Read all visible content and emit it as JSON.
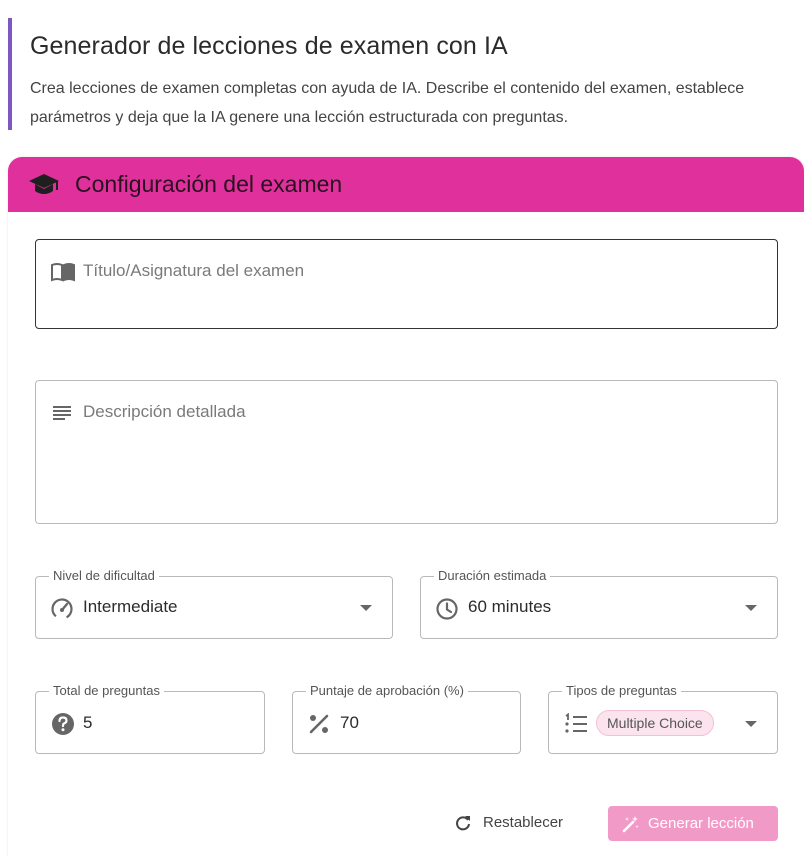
{
  "header": {
    "title": "Generador de lecciones de examen con IA",
    "description": "Crea lecciones de examen completas con ayuda de IA. Describe el contenido del examen, establece parámetros y deja que la IA genere una lección estructurada con preguntas."
  },
  "card": {
    "title": "Configuración del examen"
  },
  "form": {
    "title_placeholder": "Título/Asignatura del examen",
    "description_placeholder": "Descripción detallada",
    "difficulty": {
      "label": "Nivel de dificultad",
      "value": "Intermediate"
    },
    "duration": {
      "label": "Duración estimada",
      "value": "60 minutes"
    },
    "total_questions": {
      "label": "Total de preguntas",
      "value": "5"
    },
    "passing_score": {
      "label": "Puntaje de aprobación (%)",
      "value": "70"
    },
    "question_types": {
      "label": "Tipos de preguntas",
      "chip": "Multiple Choice"
    }
  },
  "actions": {
    "reset_label": "Restablecer",
    "generate_label": "Generar lección"
  },
  "colors": {
    "accent_bar": "#7e57c2",
    "card_header": "#e0309b",
    "generate_button_disabled": "#f29ac7",
    "chip_background": "#fbe4ee"
  },
  "icons": {
    "card_header": "graduation-cap-icon",
    "title_field": "book-icon",
    "description_field": "notes-icon",
    "difficulty": "speedometer-icon",
    "duration": "clock-icon",
    "total_questions": "question-mark-icon",
    "passing_score": "percent-icon",
    "question_types": "list-icon",
    "reset": "refresh-icon",
    "generate": "magic-wand-icon"
  }
}
